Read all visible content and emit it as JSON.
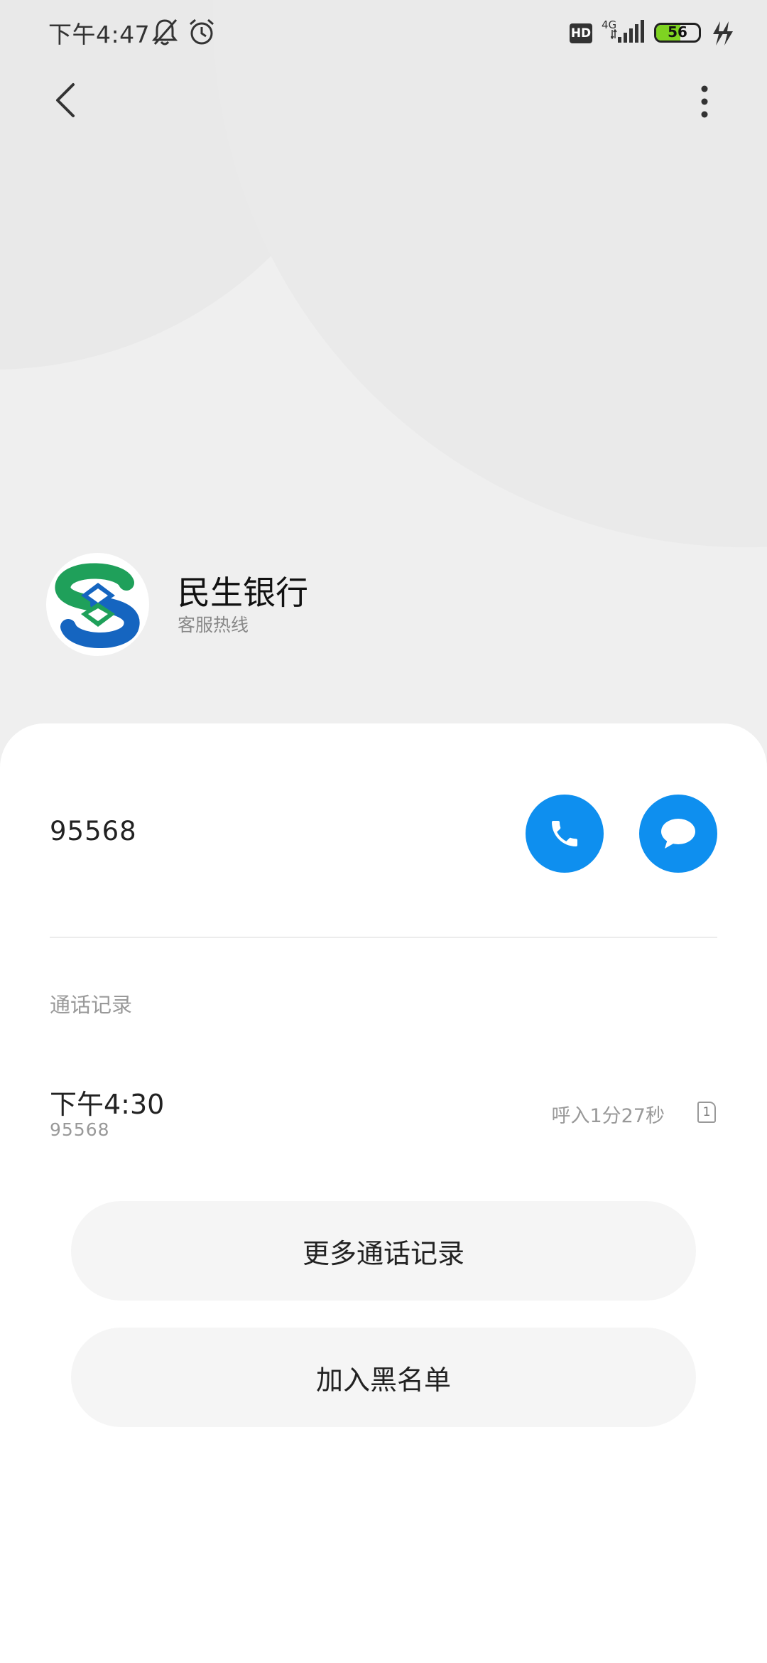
{
  "status_bar": {
    "time": "下午4:47",
    "hd_badge": "HD",
    "network": "4G",
    "battery_level": "56",
    "battery_fill_fraction": 0.56,
    "icons": [
      "mute-icon",
      "alarm-icon",
      "signal-icon",
      "battery-icon",
      "charging-icon"
    ]
  },
  "top_bar": {
    "icons": [
      "back-icon",
      "more-vertical-icon"
    ]
  },
  "contact": {
    "name": "民生银行",
    "subtitle": "客服热线",
    "avatar_icon": "bank-logo-icon",
    "logo_colors": {
      "green": "#1fa05a",
      "blue": "#1565c0"
    }
  },
  "number_row": {
    "number": "95568",
    "icons": [
      "phone-icon",
      "message-icon"
    ],
    "accent_color": "#0e8fef"
  },
  "call_log": {
    "section_label": "通话记录",
    "entries": [
      {
        "time": "下午4:30",
        "number": "95568",
        "detail": "呼入1分27秒",
        "sim": "1"
      }
    ]
  },
  "actions": {
    "more_logs": "更多通话记录",
    "blacklist": "加入黑名单"
  }
}
